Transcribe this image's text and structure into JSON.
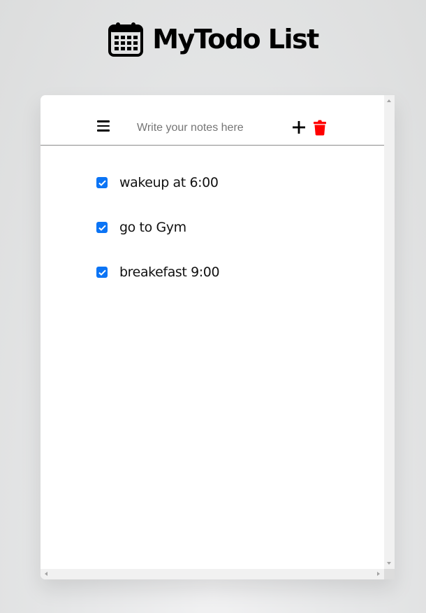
{
  "header": {
    "icon": "calendar-icon",
    "title": "MyTodo List"
  },
  "toolbar": {
    "menu_icon": "hamburger-menu-icon",
    "input_placeholder": "Write your notes here",
    "input_value": "",
    "add_icon": "plus-icon",
    "delete_icon": "trash-icon"
  },
  "todos": [
    {
      "text": "wakeup at 6:00",
      "checked": true
    },
    {
      "text": "go to Gym",
      "checked": true
    },
    {
      "text": "breakefast 9:00",
      "checked": true
    }
  ],
  "colors": {
    "checkbox_accent": "#0b74f5",
    "delete_icon": "#ff0000",
    "title_text": "#000000"
  }
}
